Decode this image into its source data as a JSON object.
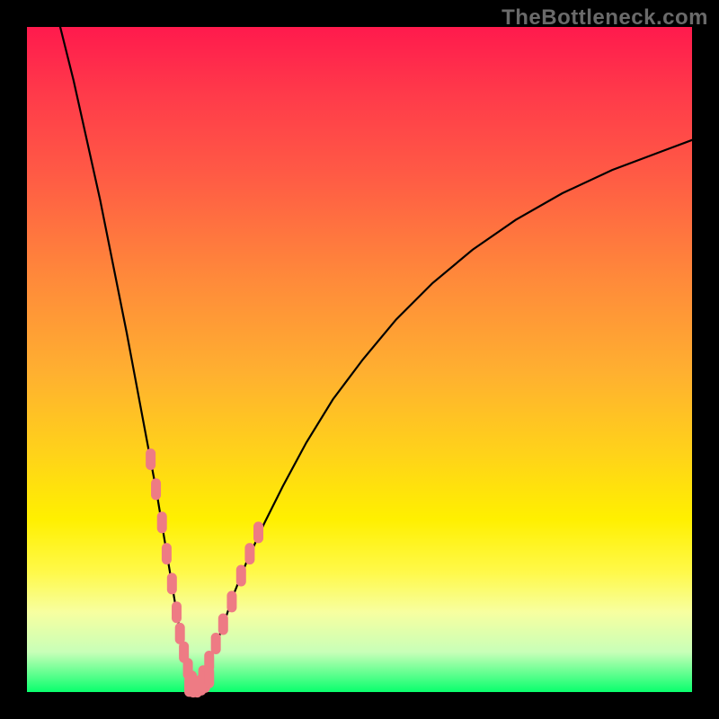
{
  "watermark": "TheBottleneck.com",
  "chart_data": {
    "type": "line",
    "title": "",
    "xlabel": "",
    "ylabel": "",
    "xlim": [
      0,
      100
    ],
    "ylim": [
      0,
      100
    ],
    "grid": false,
    "notes": "V-shaped bottleneck curve. Two black curves descend from the top edges and meet near the bottom; pink rounded markers run along the lower portions of both arms.",
    "series": [
      {
        "name": "left-arm",
        "x": [
          5,
          7,
          9,
          11,
          13,
          15,
          16.5,
          18,
          19.5,
          20.5,
          21.5,
          22.5,
          23.2,
          24.0,
          24.5,
          25.0,
          25.2
        ],
        "values": [
          100,
          92,
          83,
          74,
          64,
          54,
          46,
          38,
          30,
          24,
          18,
          12,
          8,
          4,
          2.3,
          1.2,
          0.9
        ]
      },
      {
        "name": "right-arm",
        "x": [
          25.2,
          26.0,
          26.8,
          28.0,
          29.5,
          31.0,
          33.0,
          35.5,
          38.5,
          42.0,
          46.0,
          50.5,
          55.5,
          61.0,
          67.0,
          73.5,
          80.5,
          88.0,
          96.0,
          100.0
        ],
        "values": [
          0.9,
          1.5,
          3.0,
          6.0,
          10.0,
          14.5,
          19.5,
          25.0,
          31.0,
          37.5,
          44.0,
          50.0,
          56.0,
          61.5,
          66.5,
          71.0,
          75.0,
          78.5,
          81.5,
          83.0
        ]
      },
      {
        "name": "markers-left",
        "type": "scatter",
        "x": [
          18.6,
          19.4,
          20.3,
          21.0,
          21.8,
          22.5,
          23.0,
          23.6,
          24.2,
          24.8
        ],
        "values": [
          35.0,
          30.5,
          25.5,
          20.8,
          16.3,
          12.0,
          8.8,
          6.0,
          3.5,
          1.6
        ]
      },
      {
        "name": "markers-right",
        "type": "scatter",
        "x": [
          26.5,
          27.4,
          28.4,
          29.5,
          30.8,
          32.2,
          33.5,
          34.8
        ],
        "values": [
          2.4,
          4.6,
          7.3,
          10.2,
          13.6,
          17.5,
          20.8,
          24.0
        ]
      },
      {
        "name": "markers-bottom",
        "type": "scatter",
        "x": [
          24.4,
          25.0,
          25.6,
          26.2,
          26.8,
          27.4
        ],
        "values": [
          0.9,
          0.8,
          0.8,
          1.1,
          1.5,
          2.2
        ]
      }
    ]
  }
}
